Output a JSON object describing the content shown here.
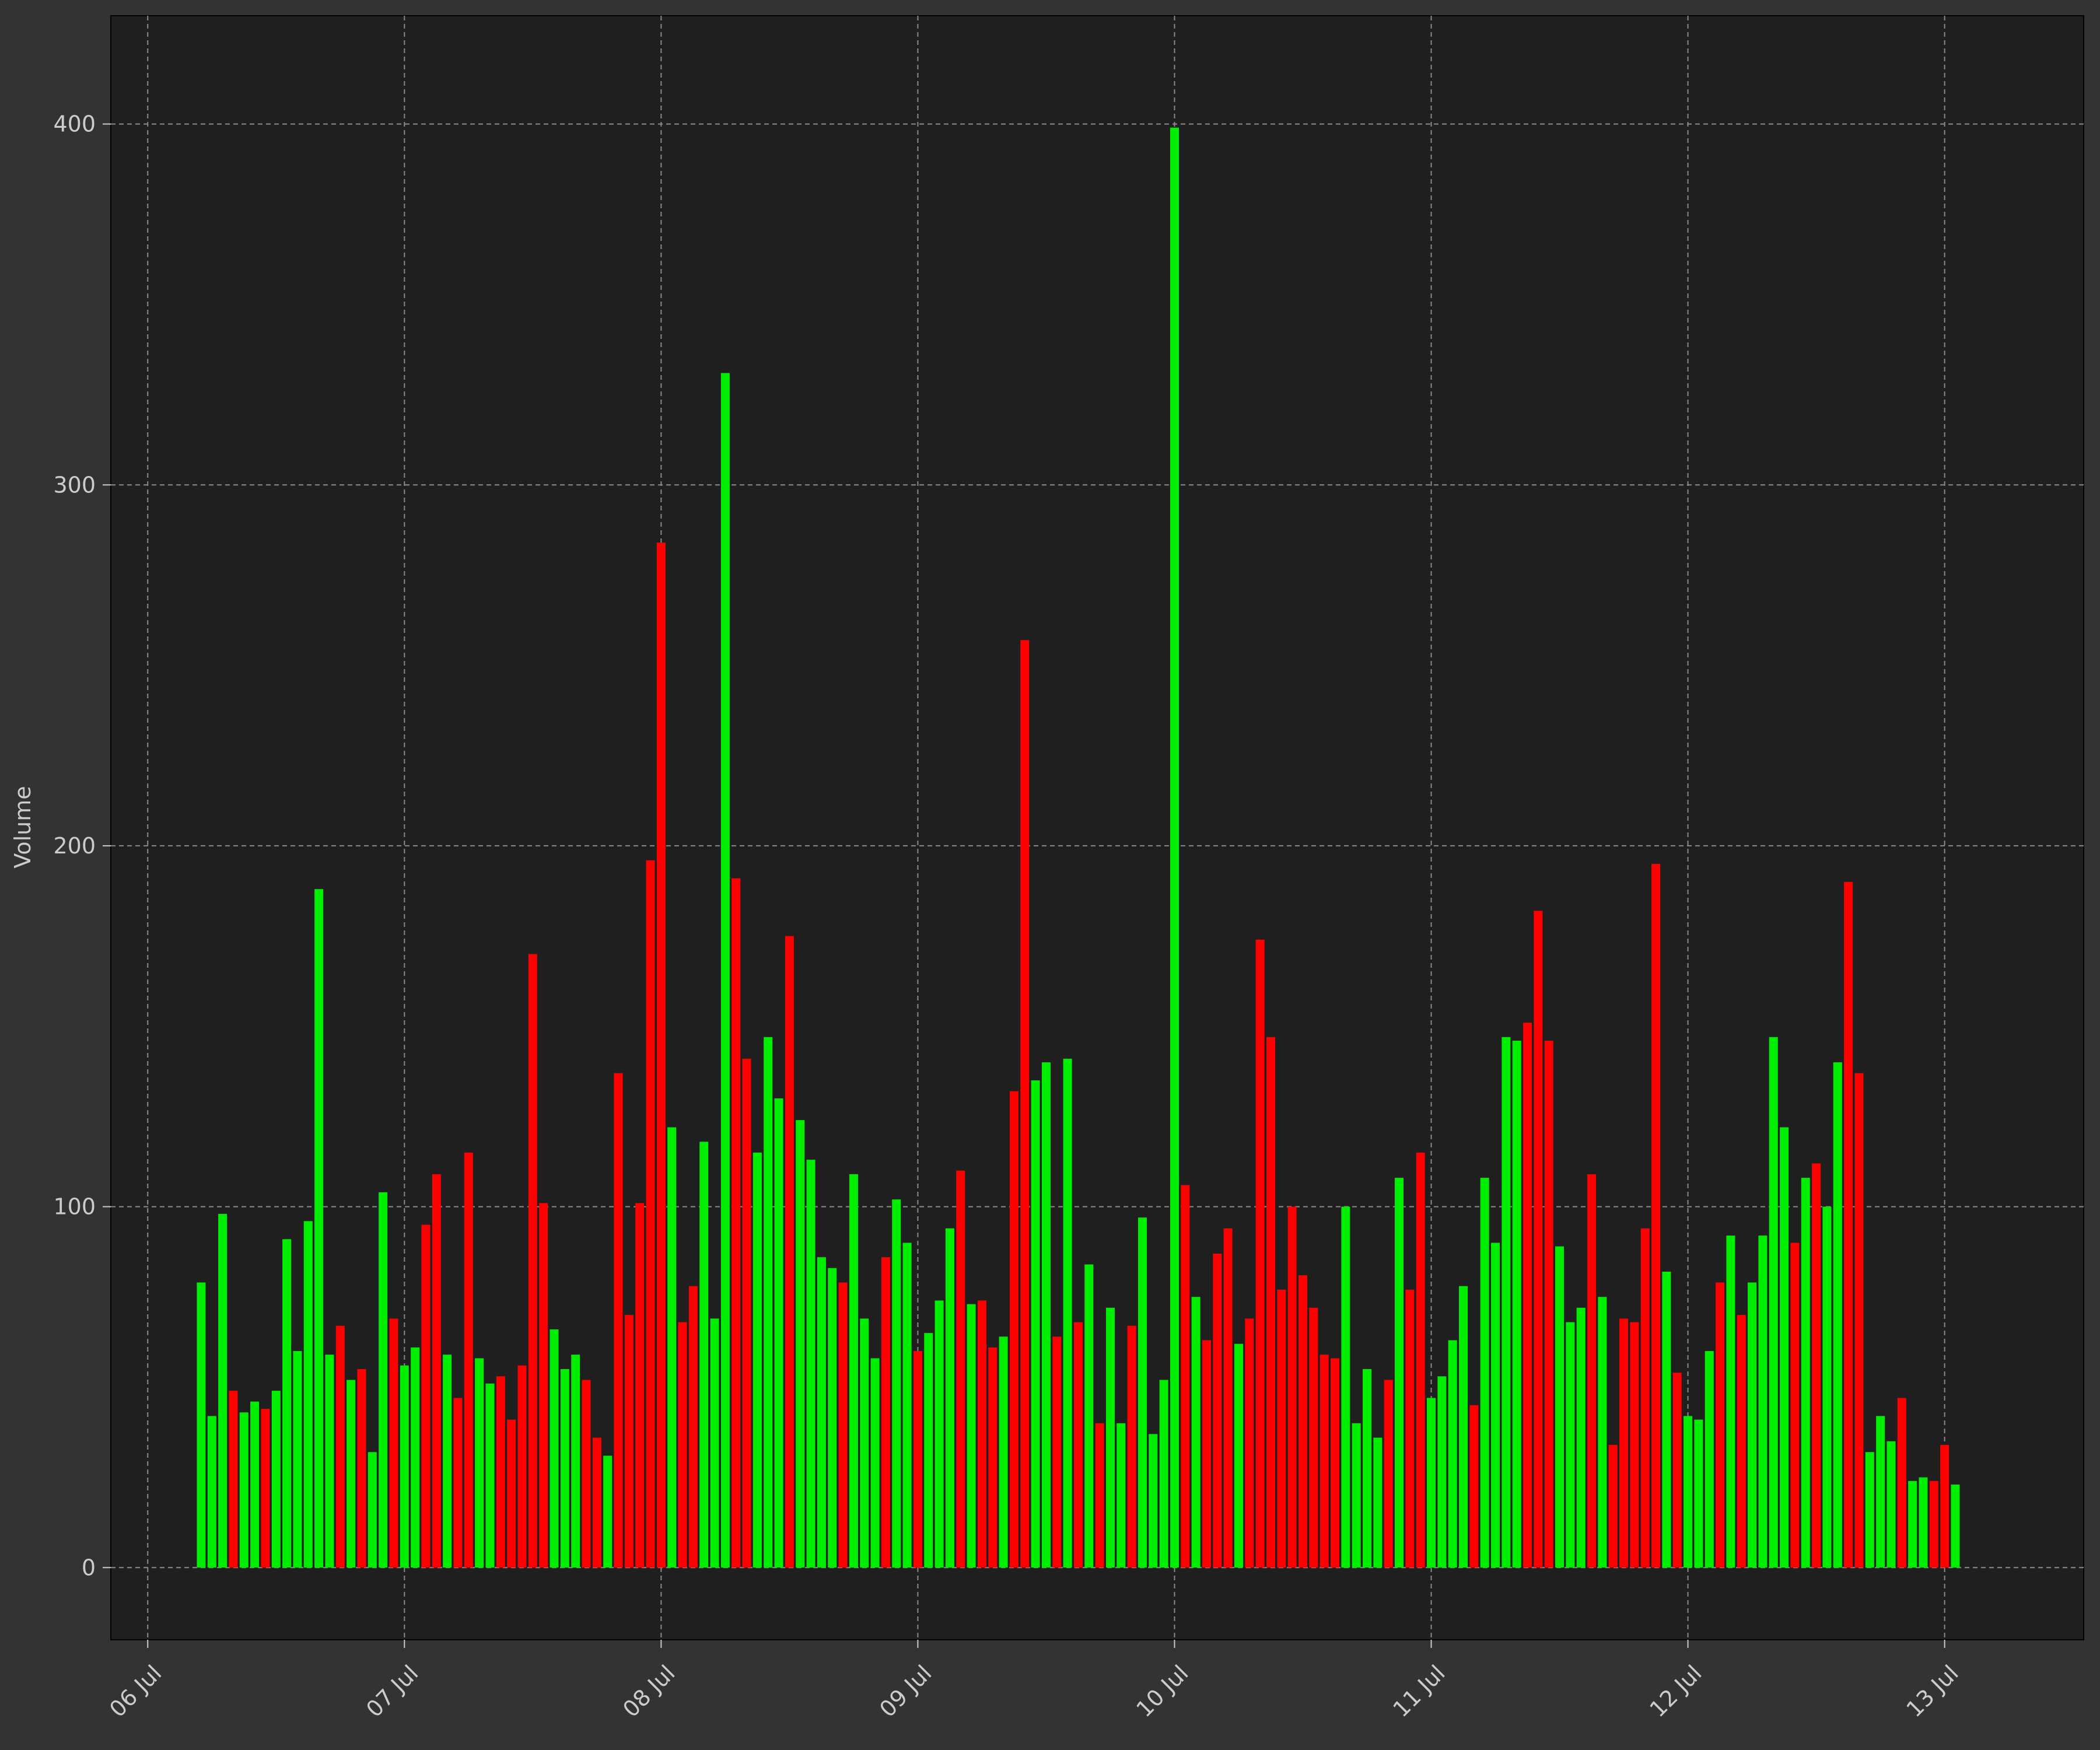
{
  "chart_data": {
    "type": "bar",
    "title": "",
    "xlabel": "",
    "ylabel": "Volume",
    "ylim": [
      -20,
      430
    ],
    "y_ticks": [
      0,
      100,
      200,
      300,
      400
    ],
    "x_range": [
      "2024-07-05T20:33",
      "2024-07-13T13:00"
    ],
    "x_ticks": [
      {
        "t": "2024-07-06T00:00",
        "label": "06 Jul"
      },
      {
        "t": "2024-07-07T00:00",
        "label": "07 Jul"
      },
      {
        "t": "2024-07-08T00:00",
        "label": "08 Jul"
      },
      {
        "t": "2024-07-09T00:00",
        "label": "09 Jul"
      },
      {
        "t": "2024-07-10T00:00",
        "label": "10 Jul"
      },
      {
        "t": "2024-07-11T00:00",
        "label": "11 Jul"
      },
      {
        "t": "2024-07-12T00:00",
        "label": "12 Jul"
      },
      {
        "t": "2024-07-13T00:00",
        "label": "13 Jul"
      }
    ],
    "grid": true,
    "bar_interval_hours": 1,
    "start": "2024-07-06T05:00",
    "colors": {
      "up": "#00ee00",
      "down": "#ff0000"
    },
    "values": [
      79,
      42,
      98,
      49,
      43,
      46,
      44,
      49,
      91,
      60,
      96,
      188,
      59,
      67,
      52,
      55,
      32,
      104,
      69,
      56,
      61,
      95,
      109,
      59,
      47,
      115,
      58,
      51,
      53,
      41,
      56,
      170,
      101,
      66,
      55,
      59,
      52,
      36,
      31,
      137,
      70,
      101,
      196,
      284,
      122,
      68,
      78,
      118,
      69,
      331,
      191,
      141,
      115,
      147,
      130,
      175,
      124,
      113,
      86,
      83,
      79,
      109,
      69,
      58,
      86,
      102,
      90,
      60,
      65,
      74,
      94,
      110,
      73,
      74,
      61,
      64,
      132,
      257,
      135,
      140,
      64,
      141,
      68,
      84,
      40,
      72,
      40,
      67,
      97,
      37,
      52,
      399,
      106,
      75,
      63,
      87,
      94,
      62,
      69,
      174,
      147,
      77,
      100,
      81,
      72,
      59,
      58,
      100,
      40,
      55,
      36,
      52,
      108,
      77,
      115,
      47,
      53,
      63,
      78,
      45,
      108,
      90,
      147,
      146,
      151,
      182,
      146,
      89,
      68,
      72,
      109,
      75,
      34,
      69,
      68,
      94,
      195,
      82,
      54,
      42,
      41,
      60,
      79,
      92,
      70,
      79,
      92,
      147,
      122,
      90,
      108,
      112,
      100,
      140,
      190,
      137,
      32,
      42,
      35,
      47,
      24,
      25,
      24,
      34,
      23
    ],
    "directions": [
      "up",
      "up",
      "up",
      "down",
      "up",
      "up",
      "down",
      "up",
      "up",
      "up",
      "up",
      "up",
      "up",
      "down",
      "up",
      "down",
      "up",
      "up",
      "down",
      "up",
      "up",
      "down",
      "down",
      "up",
      "down",
      "down",
      "up",
      "up",
      "down",
      "down",
      "down",
      "down",
      "down",
      "up",
      "up",
      "up",
      "down",
      "down",
      "up",
      "down",
      "down",
      "down",
      "down",
      "down",
      "up",
      "down",
      "down",
      "up",
      "up",
      "up",
      "down",
      "down",
      "up",
      "up",
      "up",
      "down",
      "up",
      "up",
      "up",
      "up",
      "down",
      "up",
      "up",
      "up",
      "down",
      "up",
      "up",
      "down",
      "up",
      "up",
      "up",
      "down",
      "up",
      "down",
      "down",
      "up",
      "down",
      "down",
      "up",
      "up",
      "down",
      "up",
      "down",
      "up",
      "down",
      "up",
      "up",
      "down",
      "up",
      "up",
      "up",
      "up",
      "down",
      "up",
      "down",
      "down",
      "down",
      "up",
      "down",
      "down",
      "down",
      "down",
      "down",
      "down",
      "down",
      "down",
      "down",
      "up",
      "up",
      "up",
      "up",
      "down",
      "up",
      "down",
      "down",
      "up",
      "up",
      "up",
      "up",
      "down",
      "up",
      "up",
      "up",
      "up",
      "down",
      "down",
      "down",
      "up",
      "up",
      "up",
      "down",
      "up",
      "down",
      "down",
      "down",
      "down",
      "down",
      "up",
      "down",
      "up",
      "up",
      "up",
      "down",
      "up",
      "down",
      "up",
      "up",
      "up",
      "up",
      "down",
      "up",
      "down",
      "up",
      "up",
      "down",
      "down",
      "up",
      "up",
      "up",
      "down",
      "up",
      "up",
      "down",
      "down",
      "up"
    ]
  }
}
